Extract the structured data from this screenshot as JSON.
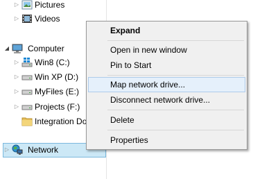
{
  "tree": {
    "pictures": "Pictures",
    "videos": "Videos",
    "computer": "Computer",
    "drives": [
      "Win8 (C:)",
      "Win XP (D:)",
      "MyFiles (E:)",
      "Projects (F:)",
      "Integration Do"
    ],
    "network": "Network"
  },
  "context_menu": {
    "expand": "Expand",
    "open_new_window": "Open in new window",
    "pin_to_start": "Pin to Start",
    "map_network_drive": "Map network drive...",
    "disconnect_network_drive": "Disconnect network drive...",
    "delete": "Delete",
    "properties": "Properties"
  },
  "colors": {
    "selection_fill": "#cce8f6",
    "selection_border": "#7ab8dd",
    "menu_background": "#f0f0f0",
    "menu_hover": "#e5f0fb"
  }
}
